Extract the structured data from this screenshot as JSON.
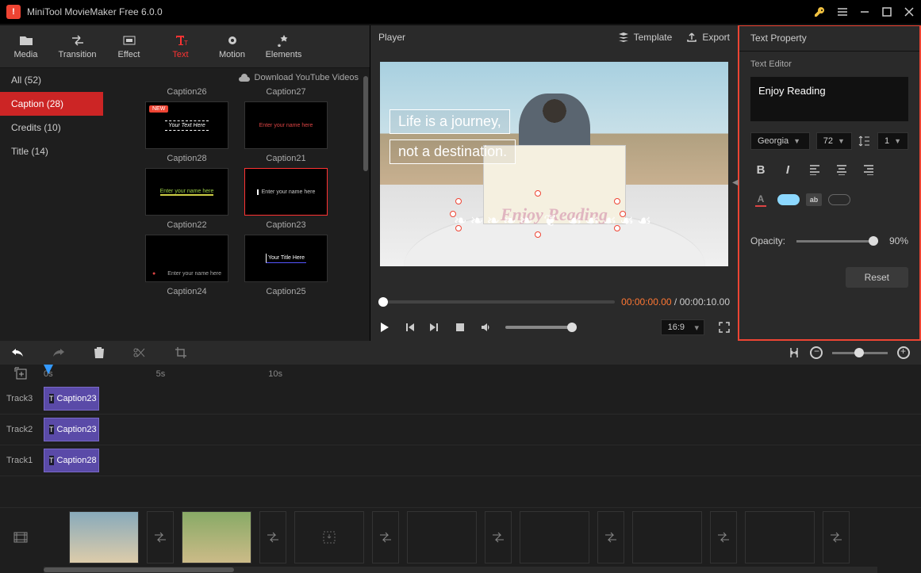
{
  "titlebar": {
    "title": "MiniTool MovieMaker Free 6.0.0"
  },
  "toolbar": {
    "items": [
      "Media",
      "Transition",
      "Effect",
      "Text",
      "Motion",
      "Elements"
    ],
    "active": 3
  },
  "sidebar": {
    "items": [
      "All (52)",
      "Caption (28)",
      "Credits (10)",
      "Title (14)"
    ],
    "active": 1
  },
  "catalog": {
    "download": "Download YouTube Videos",
    "labels_top": [
      "Caption26",
      "Caption27"
    ],
    "row1": [
      {
        "label": "Caption28",
        "text": "Your Text Here",
        "new": true
      },
      {
        "label": "Caption21",
        "text": "Enter your name here"
      }
    ],
    "row2": [
      {
        "label": "Caption22",
        "text": "Enter your name here"
      },
      {
        "label": "Caption23",
        "text": "Enter your name here",
        "selected": true
      }
    ],
    "row3": [
      {
        "label": "Caption24",
        "text": "Enter your name here"
      },
      {
        "label": "Caption25",
        "text": "Your Title Here"
      }
    ]
  },
  "player": {
    "title": "Player",
    "template": "Template",
    "export": "Export",
    "overlay1": "Life is a journey,",
    "overlay2": "not a destination.",
    "enjoy": "Enjoy Reading",
    "time_current": "00:00:00.00",
    "time_total": "00:00:10.00",
    "aspect": "16:9"
  },
  "text_property": {
    "header": "Text Property",
    "editor_label": "Text Editor",
    "text_value": "Enjoy Reading",
    "font": "Georgia",
    "size": "72",
    "line_height": "1",
    "text_color": "#8cd8ff",
    "highlight_color": "#555",
    "opacity_label": "Opacity:",
    "opacity_value": "90%",
    "reset": "Reset"
  },
  "timeline": {
    "ruler": [
      "0s",
      "5s",
      "10s"
    ],
    "tracks": [
      {
        "label": "Track3",
        "clip": "Caption23"
      },
      {
        "label": "Track2",
        "clip": "Caption23"
      },
      {
        "label": "Track1",
        "clip": "Caption28"
      }
    ]
  }
}
